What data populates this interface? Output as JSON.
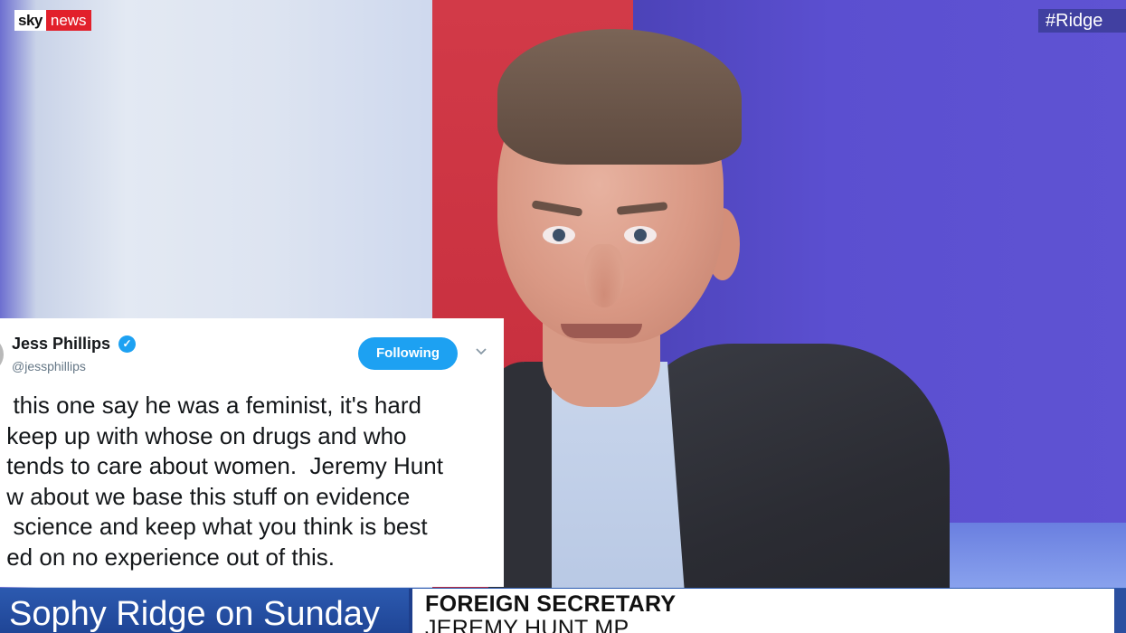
{
  "broadcast": {
    "logo_sky": "sky",
    "logo_news": "news",
    "hashtag": "#Ridge"
  },
  "tweet": {
    "name": "Jess Phillips",
    "handle": "@jessphillips",
    "follow_label": "Following",
    "lines": [
      "  this one say he was a feminist, it's hard",
      " keep up with whose on drugs and who",
      " tends to care about women.  Jeremy Hunt",
      " w about we base this stuff on evidence",
      "  science and keep what you think is best",
      " ed on no experience out of this."
    ]
  },
  "lower_third": {
    "show": "Sophy Ridge on Sunday",
    "caption_title": "FOREIGN SECRETARY",
    "caption_name": "JEREMY HUNT MP"
  },
  "colors": {
    "twitter_blue": "#1da1f2",
    "sky_red": "#e2202b",
    "lower_third_blue": "#2c5ab0"
  }
}
